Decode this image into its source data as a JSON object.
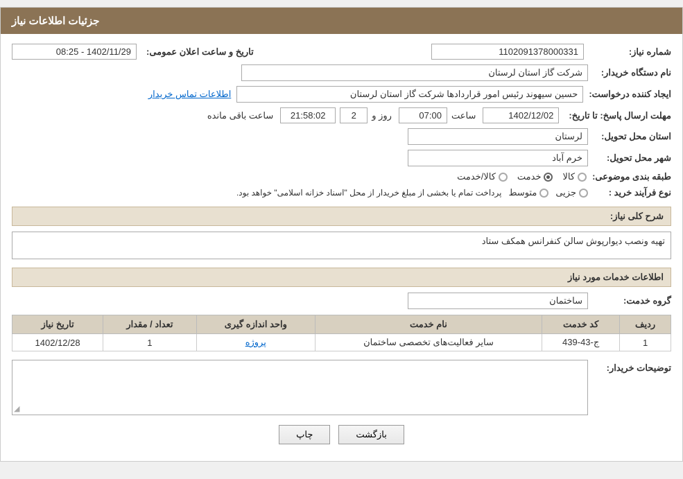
{
  "header": {
    "title": "جزئیات اطلاعات نیاز"
  },
  "fields": {
    "shomareNiaz_label": "شماره نیاز:",
    "shomareNiaz_value": "1102091378000331",
    "namDastgah_label": "نام دستگاه خریدار:",
    "namDastgah_value": "شرکت گاز استان لرستان",
    "ijadKonande_label": "ایجاد کننده درخواست:",
    "ijadKonande_value": "حسین سیهوند رئیس امور قراردادها شرکت گاز استان لرستان",
    "ijadKonande_link": "اطلاعات تماس خریدار",
    "mohlatErsal_label": "مهلت ارسال پاسخ: تا تاریخ:",
    "date_value": "1402/12/02",
    "time_label": "ساعت",
    "time_value": "07:00",
    "day_value": "2",
    "remaining_label": "ساعت باقی مانده",
    "remaining_value": "21:58:02",
    "ostan_label": "استان محل تحویل:",
    "ostan_value": "لرستان",
    "shahr_label": "شهر محل تحویل:",
    "shahr_value": "خرم آباد",
    "tabaqe_label": "طبقه بندی موضوعی:",
    "radio1": "کالا",
    "radio2": "خدمت",
    "radio3": "کالا/خدمت",
    "selected_radio": "خدمت",
    "noeFarayand_label": "نوع فرآیند خرید :",
    "noeFarayand_radio1": "جزیی",
    "noeFarayand_radio2": "متوسط",
    "noeFarayand_note": "پرداخت تمام یا بخشی از مبلغ خریدار از محل \"اسناد خزانه اسلامی\" خواهد بود.",
    "taarikh_elam_label": "تاریخ و ساعت اعلان عمومی:",
    "taarikh_elam_value": "1402/11/29 - 08:25",
    "sharh_label": "شرح کلی نیاز:",
    "sharh_value": "تهیه ونصب دیوارپوش سالن کنفرانس همکف ستاد",
    "khadamat_label": "اطلاعات خدمات مورد نیاز",
    "gorohe_khadamat_label": "گروه خدمت:",
    "gorohe_khadamat_value": "ساختمان",
    "table": {
      "headers": [
        "ردیف",
        "کد خدمت",
        "نام خدمت",
        "واحد اندازه گیری",
        "تعداد / مقدار",
        "تاریخ نیاز"
      ],
      "rows": [
        {
          "radif": "1",
          "kod": "ج-43-439",
          "name": "سایر فعالیت‌های تخصصی ساختمان",
          "vahed": "پروژه",
          "tedad": "1",
          "tarikh": "1402/12/28"
        }
      ]
    },
    "buyer_desc_label": "توضیحات خریدار:",
    "buyer_desc_value": ""
  },
  "buttons": {
    "print_label": "چاپ",
    "back_label": "بازگشت"
  }
}
